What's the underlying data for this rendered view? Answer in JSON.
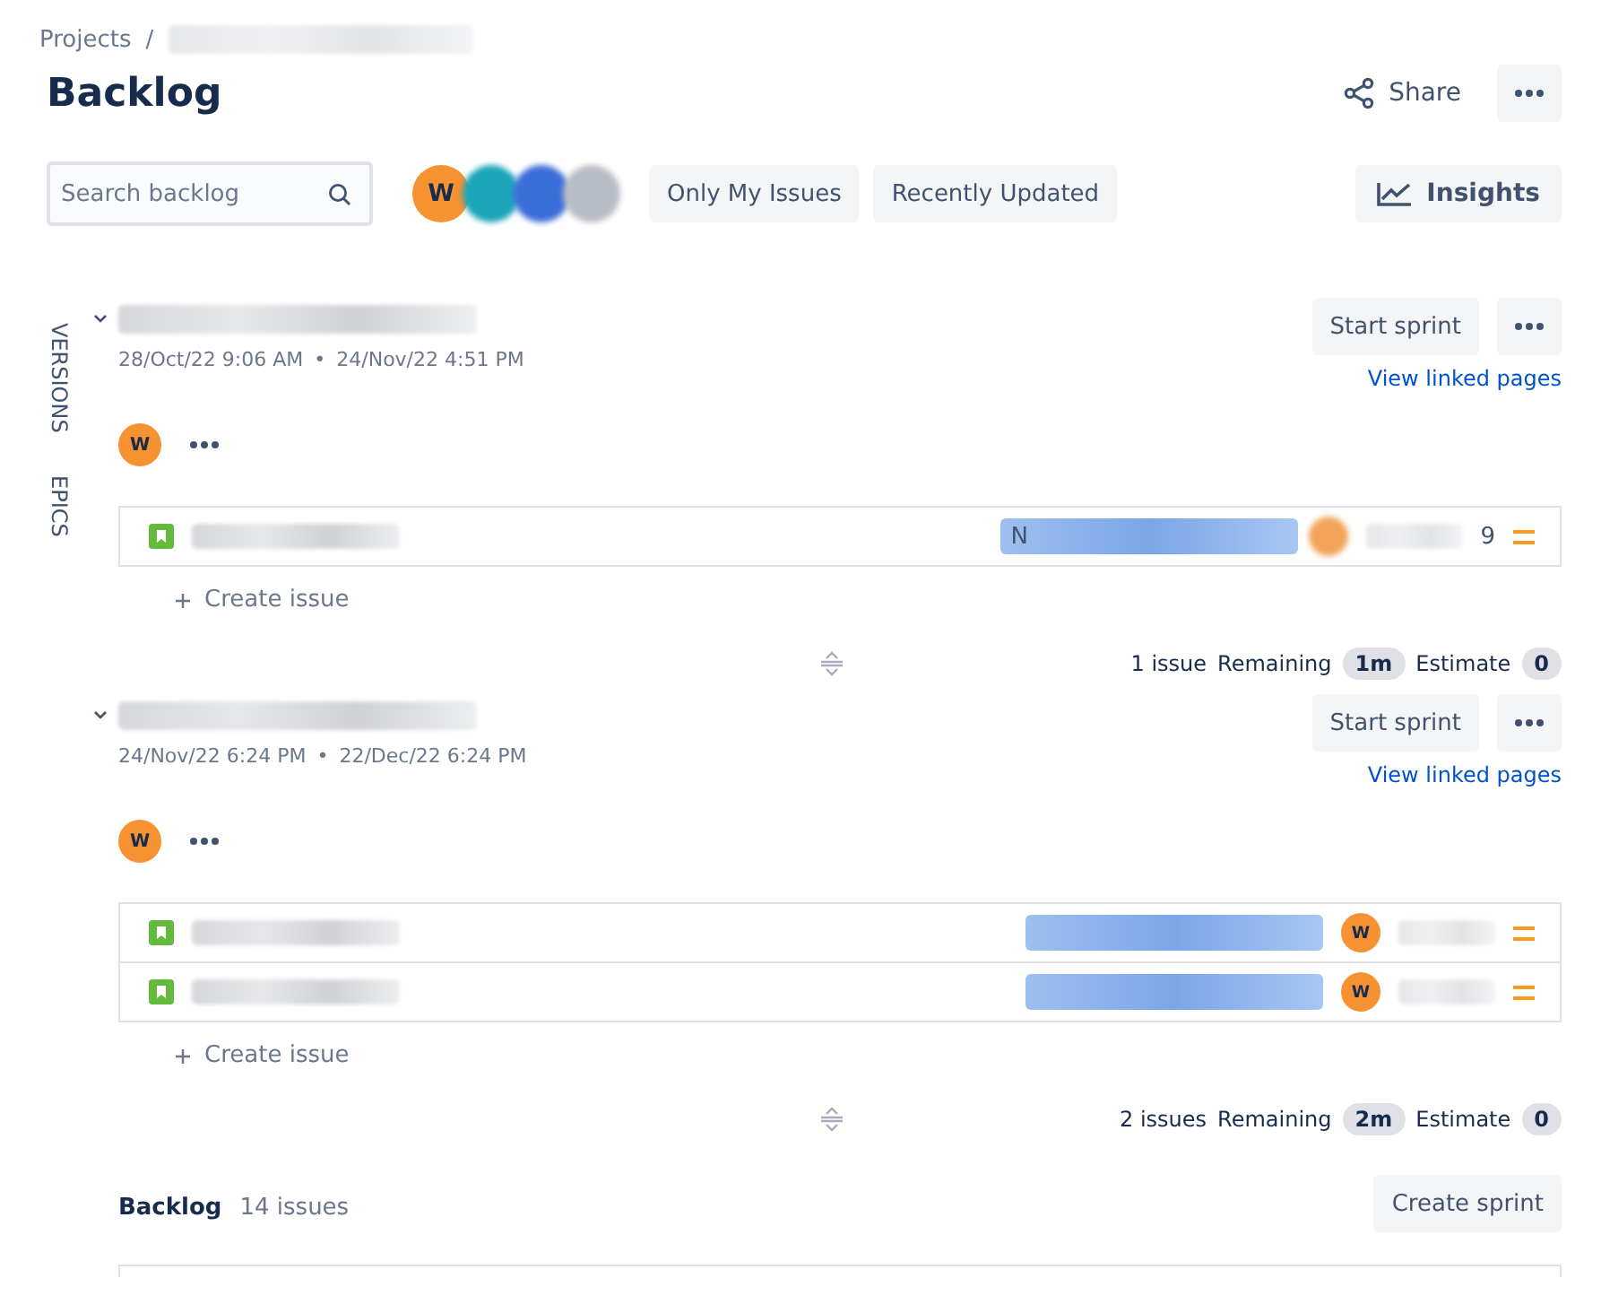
{
  "breadcrumbs": {
    "root": "Projects",
    "separator": "/"
  },
  "title": "Backlog",
  "share": {
    "label": "Share"
  },
  "toolbar": {
    "search": {
      "placeholder": "Search backlog"
    },
    "avatar": {
      "initial": "W"
    },
    "filters": [
      {
        "label": "Only My Issues",
        "selected": false
      },
      {
        "label": "Recently Updated",
        "selected": false
      }
    ],
    "insights": "Insights"
  },
  "side_tabs": [
    "VERSIONS",
    "EPICS"
  ],
  "sprints": [
    {
      "start": "28/Oct/22 9:06 AM",
      "separator": "•",
      "end": "24/Nov/22 4:51 PM",
      "start_button": "Start sprint",
      "link": "View linked pages",
      "assignee": "W",
      "issues": [
        {
          "epic_initial": "N",
          "tail": "9"
        }
      ],
      "create": "Create issue",
      "count": "1 issue",
      "remaining_label": "Remaining",
      "remaining": "1m",
      "estimate_label": "Estimate",
      "estimate": "0"
    },
    {
      "start": "24/Nov/22 6:24 PM",
      "separator": "•",
      "end": "22/Dec/22 6:24 PM",
      "start_button": "Start sprint",
      "link": "View linked pages",
      "assignee": "W",
      "issues": [
        {
          "assignee": "W"
        },
        {
          "assignee": "W"
        }
      ],
      "create": "Create issue",
      "count": "2 issues",
      "remaining_label": "Remaining",
      "remaining": "2m",
      "estimate_label": "Estimate",
      "estimate": "0"
    }
  ],
  "backlog": {
    "title": "Backlog",
    "count": "14 issues",
    "button": "Create sprint"
  }
}
